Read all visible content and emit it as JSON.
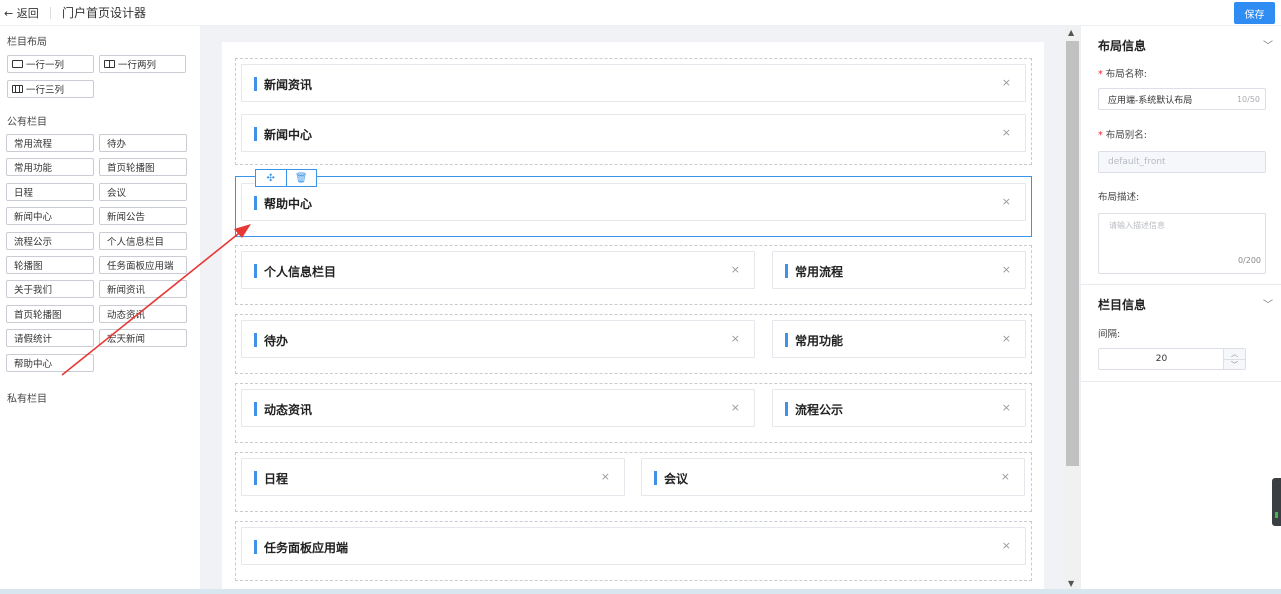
{
  "header": {
    "back_label": "← 返回",
    "title": "门户首页设计器",
    "save_label": "保存"
  },
  "left": {
    "layout_title": "栏目布局",
    "layouts": [
      "一行一列",
      "一行两列",
      "一行三列"
    ],
    "public_title": "公有栏目",
    "public_items": [
      "常用流程",
      "待办",
      "常用功能",
      "首页轮播图",
      "日程",
      "会议",
      "新闻中心",
      "新闻公告",
      "流程公示",
      "个人信息栏目",
      "轮播图",
      "任务面板应用端",
      "关于我们",
      "新闻资讯",
      "首页轮播图",
      "动态资讯",
      "请假统计",
      "宏天新闻",
      "帮助中心"
    ],
    "private_title": "私有栏目"
  },
  "canvas": {
    "rows": [
      {
        "cards": [
          "新闻资讯",
          "新闻中心"
        ]
      },
      {
        "cards": [
          "帮助中心"
        ],
        "selected": true
      },
      {
        "cards": [
          "个人信息栏目",
          "常用流程"
        ]
      },
      {
        "cards": [
          "待办",
          "常用功能"
        ]
      },
      {
        "cards": [
          "动态资讯",
          "流程公示"
        ]
      },
      {
        "cards": [
          "日程",
          "会议"
        ]
      },
      {
        "cards": [
          "任务面板应用端"
        ]
      }
    ],
    "close_glyph": "×",
    "move_glyph": "✣",
    "delete_glyph": "🗑"
  },
  "right": {
    "layout_info_title": "布局信息",
    "name_label": "布局名称:",
    "name_value": "应用端-系统默认布局",
    "name_count": "10/50",
    "alias_label": "布局别名:",
    "alias_value": "default_front",
    "desc_label": "布局描述:",
    "desc_placeholder": "请输入描述信息",
    "desc_count": "0/200",
    "column_info_title": "栏目信息",
    "gap_label": "间隔:",
    "gap_value": "20"
  },
  "colors": {
    "accent": "#2f8cf3",
    "card_bar": "#3e92ec",
    "arrow": "#e53935"
  }
}
